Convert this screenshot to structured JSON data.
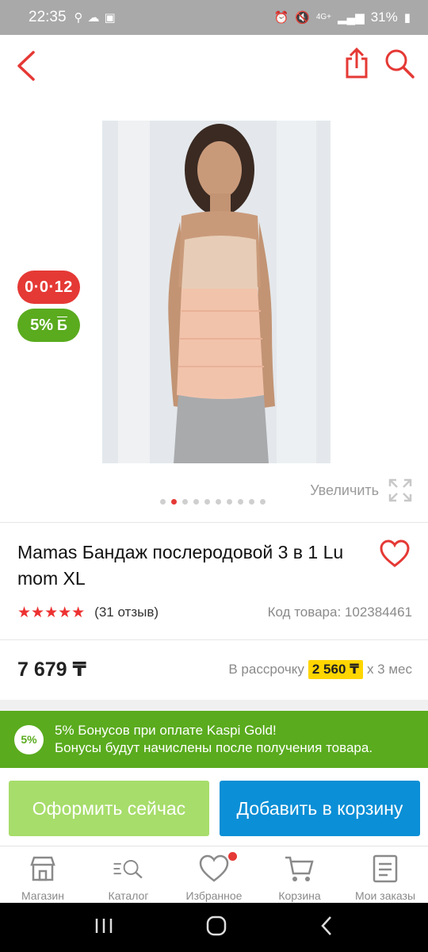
{
  "status_bar": {
    "time": "22:35",
    "battery": "31%",
    "network": "4G+"
  },
  "product": {
    "title": "Mamas Бандаж послеродовой 3 в 1 Lu mom XL",
    "rating_stars": 5,
    "reviews": "(31 отзыв)",
    "code": "Код товара: 102384461",
    "price": "7 679 ₸",
    "installment_prefix": "В рассрочку",
    "installment_amount": "2 560 ₸",
    "installment_suffix": "x 3 мес"
  },
  "badges": {
    "installment": "0·0·12",
    "bonus": "5%"
  },
  "gallery": {
    "zoom_label": "Увеличить",
    "total_images": 10,
    "active_index": 1
  },
  "bonus_banner": {
    "badge": "5%",
    "line1": "5% Бонусов при оплате Kaspi Gold!",
    "line2": "Бонусы будут начислены после получения товара."
  },
  "actions": {
    "checkout": "Оформить сейчас",
    "add_to_cart": "Добавить в корзину"
  },
  "bottom_nav": {
    "items": [
      {
        "label": "Магазин",
        "icon": "shop-icon"
      },
      {
        "label": "Каталог",
        "icon": "catalog-search-icon"
      },
      {
        "label": "Избранное",
        "icon": "heart-icon"
      },
      {
        "label": "Корзина",
        "icon": "cart-icon"
      },
      {
        "label": "Мои заказы",
        "icon": "orders-icon"
      }
    ]
  },
  "colors": {
    "accent_red": "#e53935",
    "bonus_green": "#5aab1e",
    "cart_blue": "#0b8fd6",
    "checkout_green": "#a7dd6b",
    "installment_yellow": "#ffd600"
  }
}
